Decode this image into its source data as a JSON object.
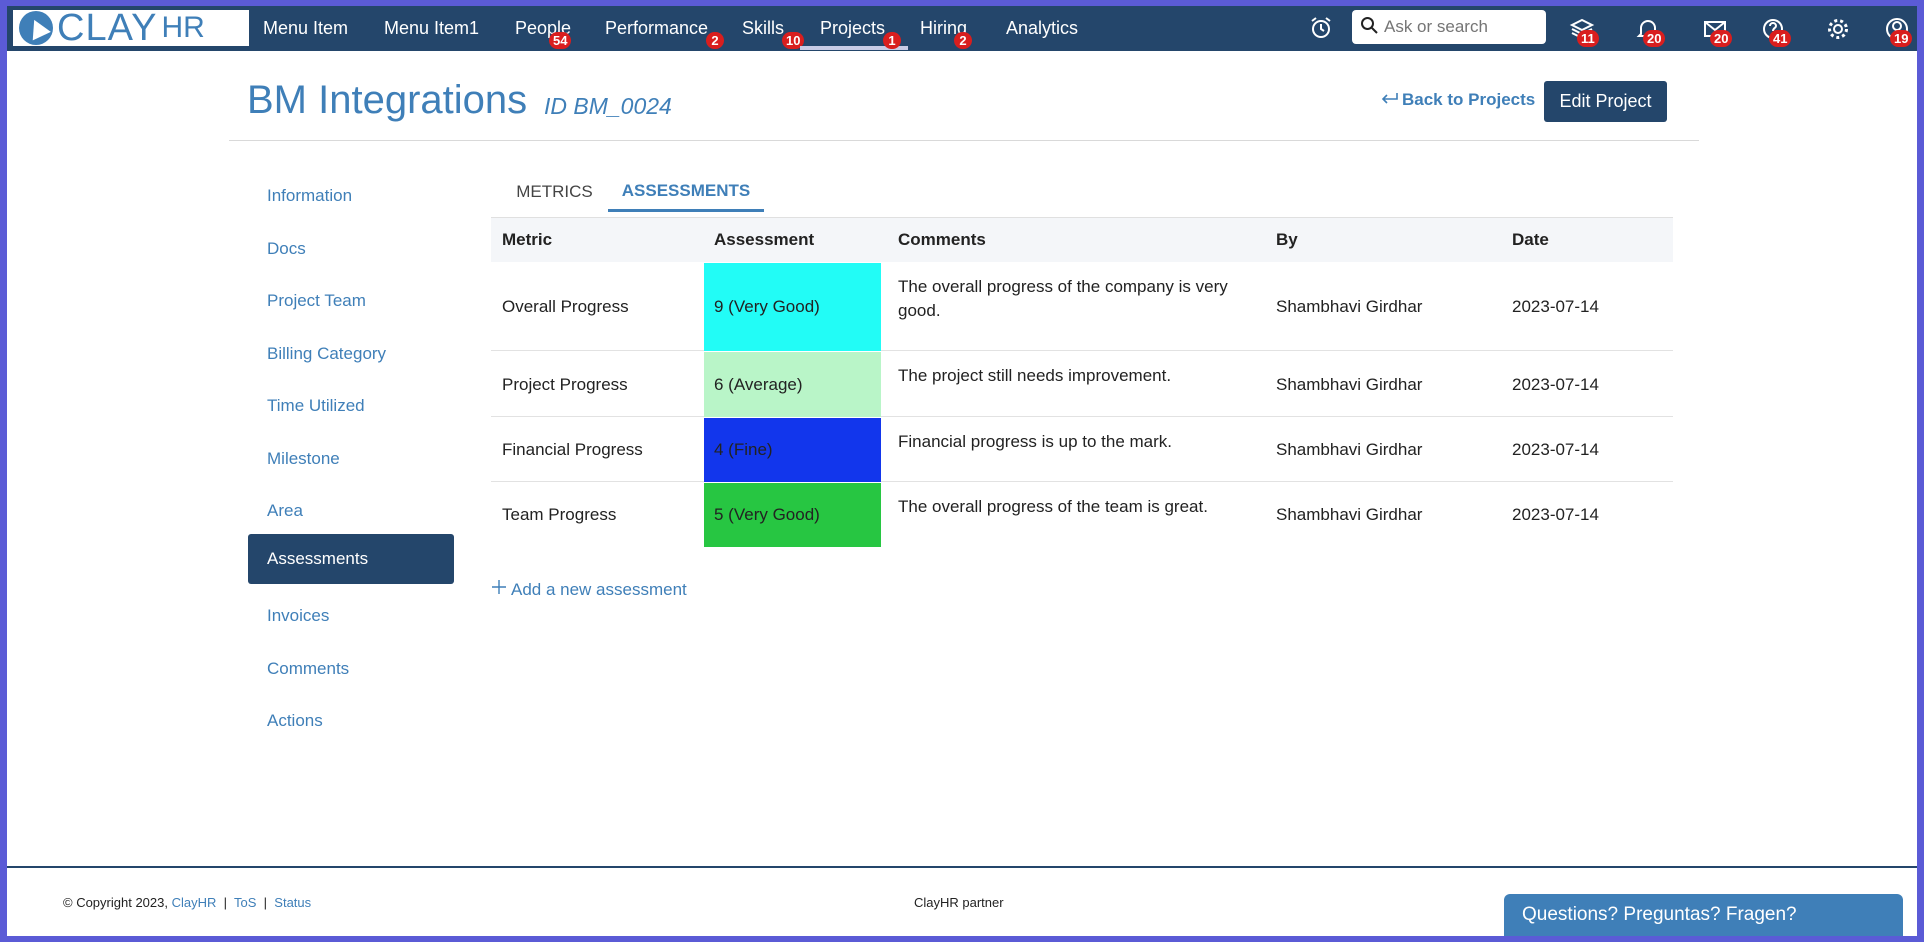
{
  "nav": {
    "logo_text": "CLAY",
    "logo_suffix": "HR",
    "items": [
      {
        "label": "Menu Item"
      },
      {
        "label": "Menu Item1"
      },
      {
        "label": "People",
        "badge": "54"
      },
      {
        "label": "Performance",
        "badge": "2"
      },
      {
        "label": "Skills",
        "badge": "10"
      },
      {
        "label": "Projects",
        "badge": "1"
      },
      {
        "label": "Hiring",
        "badge": "2"
      },
      {
        "label": "Analytics"
      }
    ],
    "search_placeholder": "Ask or search",
    "icons": [
      {
        "name": "alarm-clock-icon"
      },
      {
        "name": "stack-icon",
        "badge": "11"
      },
      {
        "name": "bell-icon",
        "badge": "20"
      },
      {
        "name": "mail-icon",
        "badge": "20"
      },
      {
        "name": "help-icon",
        "badge": "41"
      },
      {
        "name": "gear-icon"
      },
      {
        "name": "profile-icon",
        "badge": "19"
      }
    ]
  },
  "header": {
    "title": "BM Integrations",
    "id": "ID BM_0024",
    "back_label": "Back to Projects",
    "edit_label": "Edit Project"
  },
  "sidebar": {
    "items": [
      {
        "label": "Information"
      },
      {
        "label": "Docs"
      },
      {
        "label": "Project Team"
      },
      {
        "label": "Billing Category"
      },
      {
        "label": "Time Utilized"
      },
      {
        "label": "Milestone"
      },
      {
        "label": "Area"
      },
      {
        "label": "Assessments",
        "active": true
      },
      {
        "label": "Invoices"
      },
      {
        "label": "Comments"
      },
      {
        "label": "Actions"
      }
    ]
  },
  "tabs": [
    {
      "label": "METRICS"
    },
    {
      "label": "ASSESSMENTS",
      "active": true
    }
  ],
  "table": {
    "columns": [
      "Metric",
      "Assessment",
      "Comments",
      "By",
      "Date"
    ],
    "rows": [
      {
        "metric": "Overall Progress",
        "assessment": "9 (Very Good)",
        "color": "#22fcf6",
        "comment_line1": "The overall progress of the company is very",
        "comment_line2": "good.",
        "by": "Shambhavi Girdhar",
        "date": "2023-07-14"
      },
      {
        "metric": "Project Progress",
        "assessment": "6 (Average)",
        "color": "#b9f5c8",
        "comment_line1": "The project still needs improvement.",
        "comment_line2": "",
        "by": "Shambhavi Girdhar",
        "date": "2023-07-14"
      },
      {
        "metric": "Financial Progress",
        "assessment": "4 (Fine)",
        "color": "#1236ec",
        "comment_line1": "Financial progress is up to the mark.",
        "comment_line2": "",
        "by": "Shambhavi Girdhar",
        "date": "2023-07-14"
      },
      {
        "metric": "Team Progress",
        "assessment": "5 (Very Good)",
        "color": "#27c642",
        "comment_line1": "The overall progress of the team is great.",
        "comment_line2": "",
        "by": "Shambhavi Girdhar",
        "date": "2023-07-14"
      }
    ]
  },
  "add_label": "Add a new assessment",
  "footer": {
    "copyright_prefix": "© Copyright 2023,",
    "company_link": "ClayHR",
    "tos_link": "ToS",
    "status_link": "Status",
    "partner": "ClayHR partner",
    "chat_label": "Questions? Preguntas? Fragen?"
  },
  "colors": {
    "nav_bg": "#24466b",
    "accent": "#3f7fb8",
    "badge": "#d91e1e"
  }
}
